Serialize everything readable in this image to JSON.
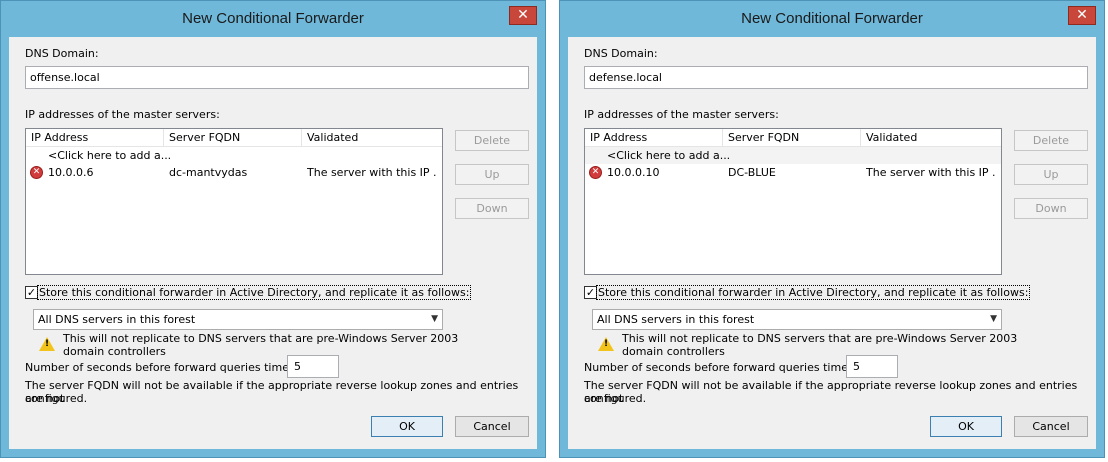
{
  "dialogs": [
    {
      "title": "New Conditional Forwarder",
      "close_glyph": "✕",
      "dns_domain_label": "DNS Domain:",
      "dns_domain_value": "offense.local",
      "ip_label": "IP addresses of the master servers:",
      "columns": [
        "IP Address",
        "Server FQDN",
        "Validated"
      ],
      "add_row": "<Click here to add a...",
      "rows": [
        {
          "ip": "10.0.0.6",
          "fqdn": "dc-mantvydas",
          "validated": "The server with this IP ...",
          "status_icon": "error-icon"
        }
      ],
      "delete_label": "Delete",
      "up_label": "Up",
      "down_label": "Down",
      "store_checked": true,
      "store_label": "Store this conditional forwarder in Active Directory, and replicate it as follows:",
      "replication_selected": "All DNS servers in this forest",
      "warning_text_line1": "This will not replicate to DNS servers that are pre-Windows Server 2003",
      "warning_text_line2": "domain controllers",
      "timeout_label": "Number of seconds before forward queries time out:",
      "timeout_value": "5",
      "fqdn_note_line1": "The server FQDN will not be available if the appropriate reverse lookup zones and entries are not",
      "fqdn_note_line2": "configured.",
      "ok_label": "OK",
      "cancel_label": "Cancel"
    },
    {
      "title": "New Conditional Forwarder",
      "close_glyph": "✕",
      "dns_domain_label": "DNS Domain:",
      "dns_domain_value": "defense.local",
      "ip_label": "IP addresses of the master servers:",
      "columns": [
        "IP Address",
        "Server FQDN",
        "Validated"
      ],
      "add_row": "<Click here to add a...",
      "rows": [
        {
          "ip": "10.0.0.10",
          "fqdn": "DC-BLUE",
          "validated": "The server with this IP ...",
          "status_icon": "error-icon"
        }
      ],
      "delete_label": "Delete",
      "up_label": "Up",
      "down_label": "Down",
      "store_checked": true,
      "store_label": "Store this conditional forwarder in Active Directory, and replicate it as follows:",
      "replication_selected": "All DNS servers in this forest",
      "warning_text_line1": "This will not replicate to DNS servers that are pre-Windows Server 2003",
      "warning_text_line2": "domain controllers",
      "timeout_label": "Number of seconds before forward queries time out:",
      "timeout_value": "5",
      "fqdn_note_line1": "The server FQDN will not be available if the appropriate reverse lookup zones and entries are not",
      "fqdn_note_line2": "configured.",
      "ok_label": "OK",
      "cancel_label": "Cancel"
    }
  ],
  "colors": {
    "title_bar": "#6fb8da",
    "close_button": "#c9463a",
    "client_background": "#f0f0f0",
    "error_icon": "#d13b3b",
    "warning_icon": "#f2c41b"
  }
}
